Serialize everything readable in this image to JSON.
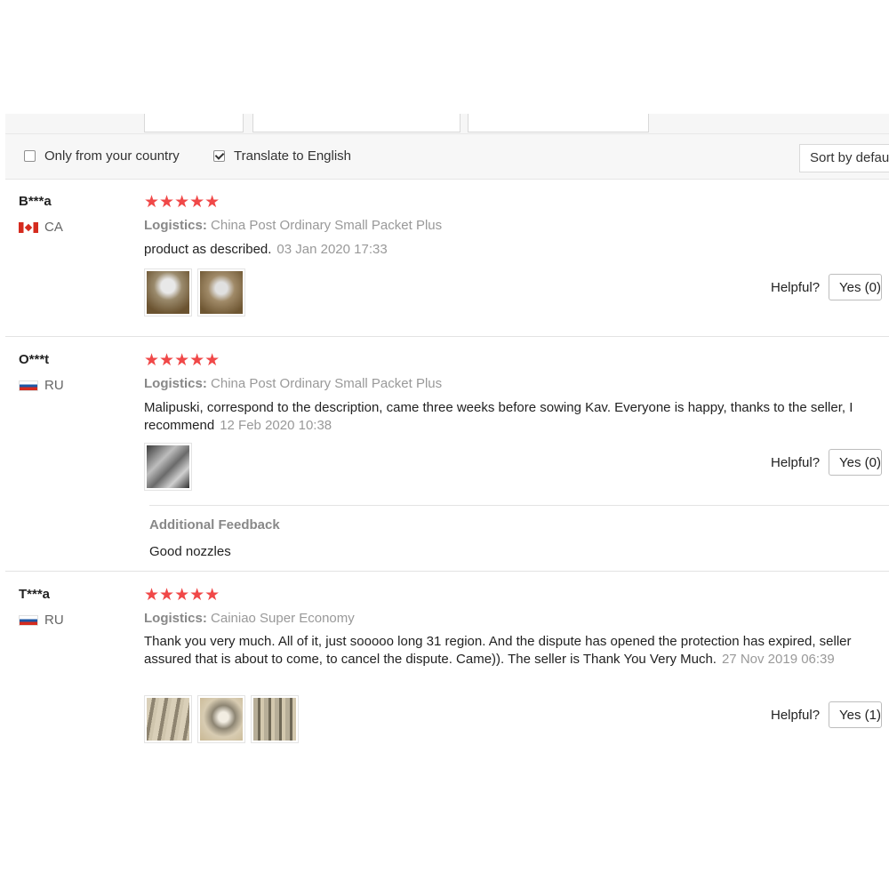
{
  "filters": {
    "only_country_label": "Only from your country",
    "only_country_checked": false,
    "translate_label": "Translate to English",
    "translate_checked": true,
    "sort_value": "Sort by default"
  },
  "reviews": [
    {
      "user": "B***a",
      "country": "CA",
      "rating": 5,
      "stars": "★★★★★",
      "logistics_label": "Logistics:",
      "logistics_value": "China Post Ordinary Small Packet Plus",
      "text": "product as described.",
      "date": "03 Jan 2020 17:33",
      "helpful_label": "Helpful?",
      "yes_label": "Yes (0)"
    },
    {
      "user": "O***t",
      "country": "RU",
      "rating": 5,
      "stars": "★★★★★",
      "logistics_label": "Logistics:",
      "logistics_value": "China Post Ordinary Small Packet Plus",
      "text": "Malipuski, correspond to the description, came three weeks before sowing Kav. Everyone is happy, thanks to the seller, I recommend",
      "date": "12 Feb 2020 10:38",
      "helpful_label": "Helpful?",
      "yes_label": "Yes (0)",
      "additional_title": "Additional Feedback",
      "additional_text": "Good nozzles"
    },
    {
      "user": "T***a",
      "country": "RU",
      "rating": 5,
      "stars": "★★★★★",
      "logistics_label": "Logistics:",
      "logistics_value": "Cainiao Super Economy",
      "text": "Thank you very much. All of it, just sooooo long 31 region. And the dispute has opened the protection has expired, seller assured that is about to come, to cancel the dispute. Came)). The seller is Thank You Very Much.",
      "date": "27 Nov 2019 06:39",
      "helpful_label": "Helpful?",
      "yes_label": "Yes (1)"
    }
  ]
}
